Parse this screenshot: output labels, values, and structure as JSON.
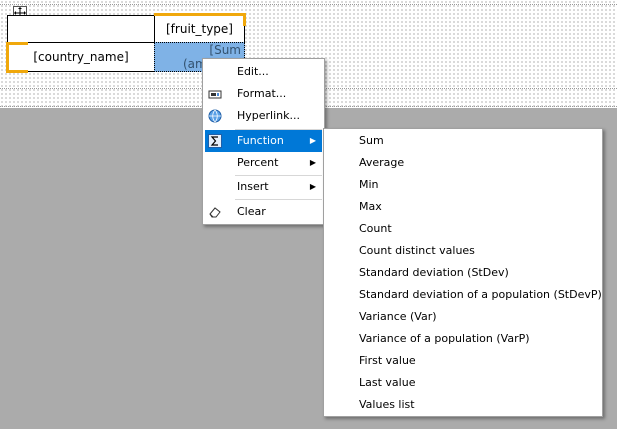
{
  "report": {
    "column_field": "[fruit_type]",
    "row_field": "[country_name]",
    "data_line1": "[Sum",
    "data_line2": "(am"
  },
  "context_menu": {
    "items": [
      {
        "label": "Edit...",
        "icon": ""
      },
      {
        "label": "Format...",
        "icon": "format-icon"
      },
      {
        "label": "Hyperlink...",
        "icon": "hyperlink-globe-icon"
      },
      {
        "label": "Function",
        "icon": "sigma-icon",
        "submenu": true
      },
      {
        "label": "Percent",
        "icon": "",
        "submenu": true
      },
      {
        "label": "Insert",
        "icon": "",
        "submenu": true
      },
      {
        "label": "Clear",
        "icon": "eraser-icon"
      }
    ],
    "arrow_glyph": "▶",
    "highlight_color": "#0078d7"
  },
  "function_submenu": {
    "items": [
      "Sum",
      "Average",
      "Min",
      "Max",
      "Count",
      "Count distinct values",
      "Standard deviation (StDev)",
      "Standard deviation of a population (StDevP)",
      "Variance (Var)",
      "Variance of a population (VarP)",
      "First value",
      "Last value",
      "Values list"
    ]
  },
  "colors": {
    "selection_border": "#f0a80c",
    "selected_cell": "#7fb2e6",
    "workspace": "#ababab"
  }
}
